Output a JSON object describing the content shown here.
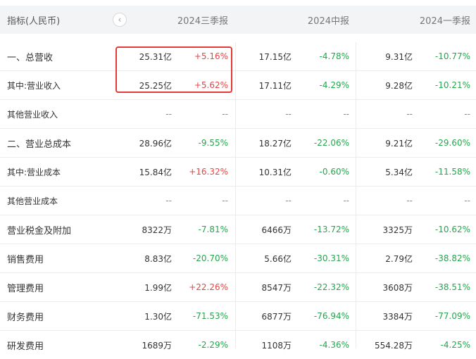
{
  "header": {
    "metric_label": "指标(人民币)",
    "nav_prev": "‹",
    "periods": [
      "2024三季报",
      "2024中报",
      "2024一季报"
    ]
  },
  "colors": {
    "up": "#e64545",
    "down": "#23a74d",
    "highlight": "#e53935"
  },
  "rows": [
    {
      "label": "一、总营收",
      "cells": [
        {
          "v": "25.31亿",
          "c": "+5.16%",
          "d": "up"
        },
        {
          "v": "17.15亿",
          "c": "-4.78%",
          "d": "down"
        },
        {
          "v": "9.31亿",
          "c": "-10.77%",
          "d": "down"
        }
      ]
    },
    {
      "label": "其中:营业收入",
      "cells": [
        {
          "v": "25.25亿",
          "c": "+5.62%",
          "d": "up"
        },
        {
          "v": "17.11亿",
          "c": "-4.29%",
          "d": "down"
        },
        {
          "v": "9.28亿",
          "c": "-10.21%",
          "d": "down"
        }
      ]
    },
    {
      "label": "其他营业收入",
      "cells": [
        {
          "v": "--",
          "c": "--",
          "d": "na"
        },
        {
          "v": "--",
          "c": "--",
          "d": "na"
        },
        {
          "v": "--",
          "c": "--",
          "d": "na"
        }
      ]
    },
    {
      "label": "二、营业总成本",
      "cells": [
        {
          "v": "28.96亿",
          "c": "-9.55%",
          "d": "down"
        },
        {
          "v": "18.27亿",
          "c": "-22.06%",
          "d": "down"
        },
        {
          "v": "9.21亿",
          "c": "-29.60%",
          "d": "down"
        }
      ]
    },
    {
      "label": "其中:营业成本",
      "cells": [
        {
          "v": "15.84亿",
          "c": "+16.32%",
          "d": "up"
        },
        {
          "v": "10.31亿",
          "c": "-0.60%",
          "d": "down"
        },
        {
          "v": "5.34亿",
          "c": "-11.58%",
          "d": "down"
        }
      ]
    },
    {
      "label": "其他营业成本",
      "cells": [
        {
          "v": "--",
          "c": "--",
          "d": "na"
        },
        {
          "v": "--",
          "c": "--",
          "d": "na"
        },
        {
          "v": "--",
          "c": "--",
          "d": "na"
        }
      ]
    },
    {
      "label": "营业税金及附加",
      "cells": [
        {
          "v": "8322万",
          "c": "-7.81%",
          "d": "down"
        },
        {
          "v": "6466万",
          "c": "-13.72%",
          "d": "down"
        },
        {
          "v": "3325万",
          "c": "-10.62%",
          "d": "down"
        }
      ]
    },
    {
      "label": "销售费用",
      "cells": [
        {
          "v": "8.83亿",
          "c": "-20.70%",
          "d": "down"
        },
        {
          "v": "5.66亿",
          "c": "-30.31%",
          "d": "down"
        },
        {
          "v": "2.79亿",
          "c": "-38.82%",
          "d": "down"
        }
      ]
    },
    {
      "label": "管理费用",
      "cells": [
        {
          "v": "1.99亿",
          "c": "+22.26%",
          "d": "up"
        },
        {
          "v": "8547万",
          "c": "-22.32%",
          "d": "down"
        },
        {
          "v": "3608万",
          "c": "-38.51%",
          "d": "down"
        }
      ]
    },
    {
      "label": "财务费用",
      "cells": [
        {
          "v": "1.30亿",
          "c": "-71.53%",
          "d": "down"
        },
        {
          "v": "6877万",
          "c": "-76.94%",
          "d": "down"
        },
        {
          "v": "3384万",
          "c": "-77.09%",
          "d": "down"
        }
      ]
    },
    {
      "label": "研发费用",
      "cells": [
        {
          "v": "1689万",
          "c": "-2.29%",
          "d": "down"
        },
        {
          "v": "1108万",
          "c": "-4.36%",
          "d": "down"
        },
        {
          "v": "554.28万",
          "c": "-4.25%",
          "d": "down"
        }
      ]
    }
  ]
}
